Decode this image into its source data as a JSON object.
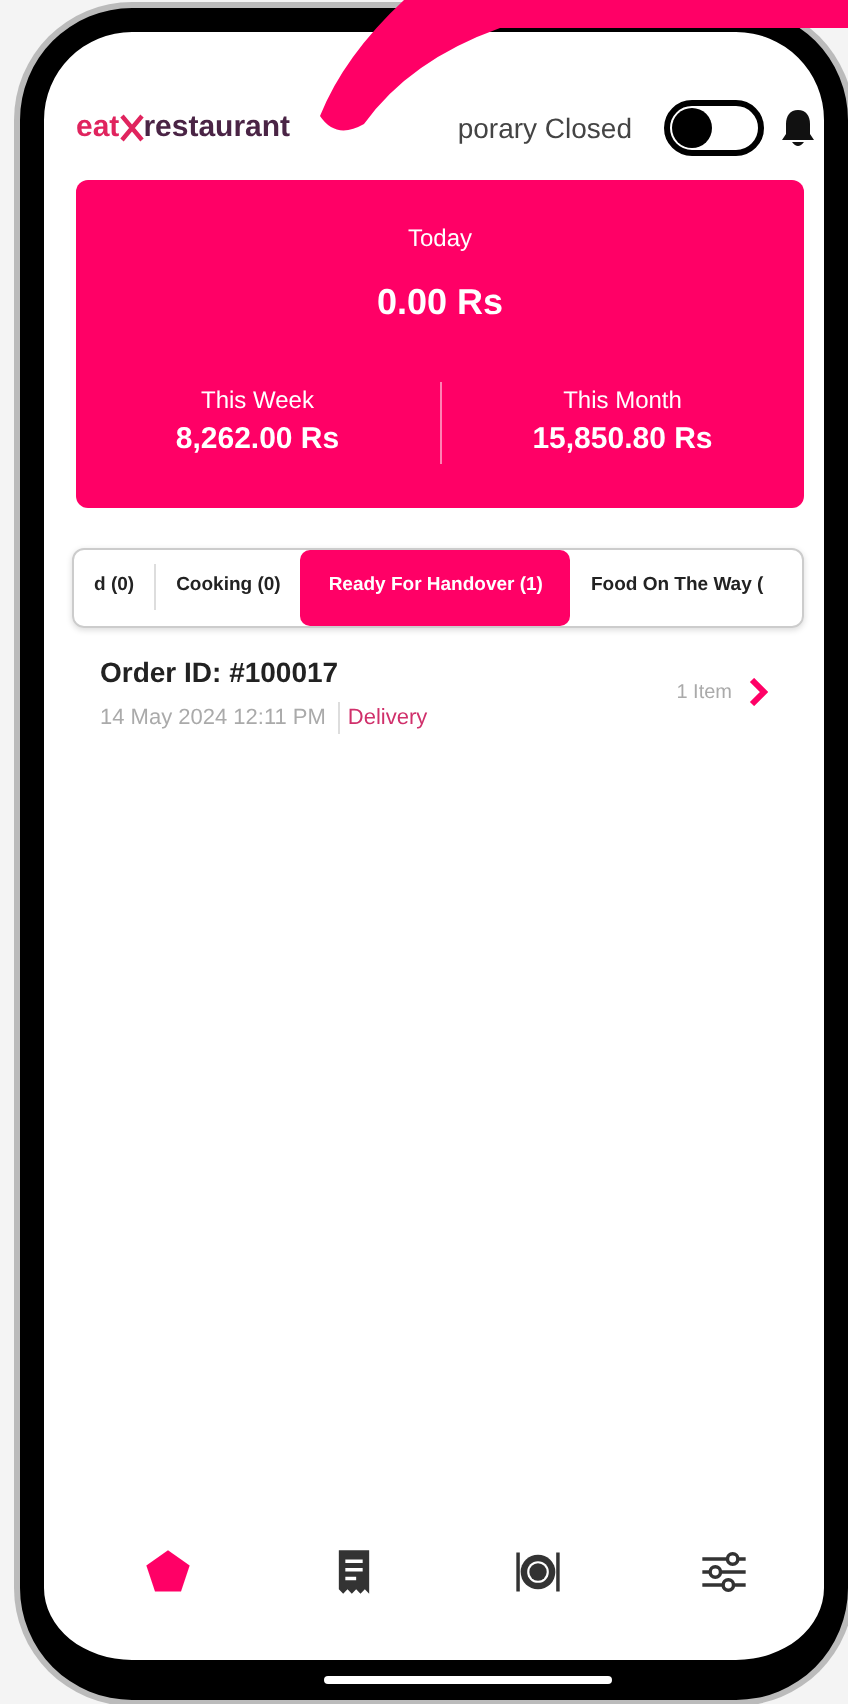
{
  "header": {
    "logo": {
      "prefix": "eat",
      "suffix": "restaurant"
    },
    "status_label": "porary Closed",
    "closed_toggle": {
      "on": false
    }
  },
  "summary": {
    "today_label": "Today",
    "today_value": "0.00 Rs",
    "stats": [
      {
        "label": "This Week",
        "value": "8,262.00 Rs"
      },
      {
        "label": "This Month",
        "value": "15,850.80 Rs"
      }
    ]
  },
  "tabs": [
    {
      "label": "d (0)",
      "selected": false
    },
    {
      "label": "Cooking (0)",
      "selected": false
    },
    {
      "label": "Ready For Handover (1)",
      "selected": true
    },
    {
      "label": "Food On The Way (",
      "selected": false
    }
  ],
  "orders": [
    {
      "id": "Order ID: #100017",
      "date": "14 May 2024  12:11 PM",
      "type": "Delivery",
      "items": "1 Item"
    }
  ],
  "bottom_nav": [
    {
      "kind": "home",
      "selected": true
    },
    {
      "kind": "orders",
      "selected": false
    },
    {
      "kind": "menu",
      "selected": false
    },
    {
      "kind": "settings",
      "selected": false
    }
  ]
}
